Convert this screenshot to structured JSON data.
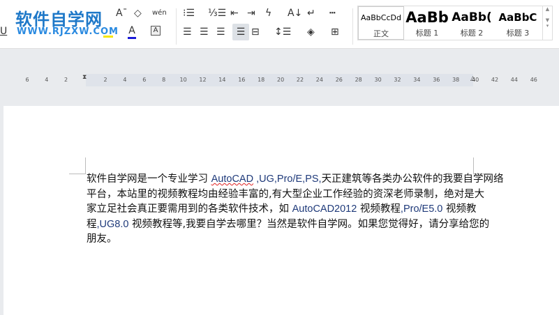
{
  "ribbon": {
    "watermark": {
      "title": "软件自学网",
      "url": "WWW.RJZXW.COM"
    },
    "font_icons": [
      "shrink-font-icon",
      "clear-format-icon",
      "phonetic-guide-icon",
      "underline-icon",
      "highlight-icon",
      "font-color-icon",
      "char-border-icon"
    ],
    "font_icon_glyphs": {
      "shrink": "Aˉ",
      "clear": "◇",
      "phonetic": "wén",
      "underline": "U",
      "fontcolor": "A",
      "border": "A"
    },
    "styles": [
      {
        "preview": "AaBbCcDd",
        "name": "正文"
      },
      {
        "preview": "AaBb",
        "name": "标题 1"
      },
      {
        "preview": "AaBb(",
        "name": "标题 2"
      },
      {
        "preview": "AaBbC",
        "name": "标题 3"
      }
    ],
    "colors": {
      "font_color": "#1a1ad8",
      "highlight": "#f5e600",
      "accent": "#1e78c8",
      "latin_text": "#1f3a7a"
    }
  },
  "ruler": {
    "left": [
      "6",
      "4",
      "2"
    ],
    "right": [
      "2",
      "4",
      "6",
      "8",
      "10",
      "12",
      "14",
      "16",
      "18",
      "20",
      "22",
      "24",
      "26",
      "28",
      "30",
      "32",
      "34",
      "36",
      "38",
      "40",
      "42",
      "44",
      "46"
    ]
  },
  "document": {
    "lines": [
      [
        {
          "t": "软件自学网是一个专业学习 "
        },
        {
          "t": "AutoCAD",
          "l": 1,
          "sq": 1
        },
        {
          "t": " ,UG,Pro/E,PS,",
          "l": 1
        },
        {
          "t": "天正建筑等各类办公软件的我要自学网络"
        }
      ],
      [
        {
          "t": "平台，本站里的视频教程均由经验丰富的,有大型企业工作经验的资深老师录制，绝对是大"
        }
      ],
      [
        {
          "t": "家立足社会真正要需用到的各类软件技术，如 "
        },
        {
          "t": "AutoCAD2012",
          "l": 1
        },
        {
          "t": " 视频教程"
        },
        {
          "t": ",Pro/E5.0",
          "l": 1
        },
        {
          "t": " 视频教"
        }
      ],
      [
        {
          "t": "程"
        },
        {
          "t": ",UG8.0",
          "l": 1
        },
        {
          "t": " 视频教程等,我要自学去哪里？当然是软件自学网。如果您觉得好，请分享给您的"
        }
      ],
      [
        {
          "t": "朋友。"
        }
      ]
    ]
  }
}
